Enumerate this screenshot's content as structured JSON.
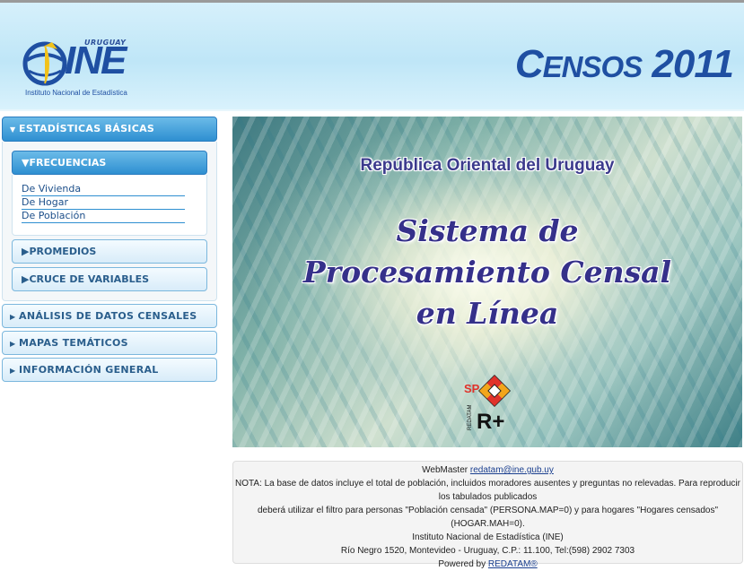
{
  "header": {
    "logo": {
      "country": "URUGUAY",
      "acronym": "INE",
      "subtitle": "Instituto Nacional de Estadística"
    },
    "censos_title_first": "C",
    "censos_title_rest": "ENSOS",
    "censos_year": "2011"
  },
  "sidebar": {
    "estadisticas_basicas": "ESTADÍSTICAS BÁSICAS",
    "frecuencias": "FRECUENCIAS",
    "frecuencias_links": [
      "De Vivienda",
      "De Hogar",
      "De Población"
    ],
    "promedios": "PROMEDIOS",
    "cruce_variables": "CRUCE DE VARIABLES",
    "analisis": "ANÁLISIS DE DATOS CENSALES",
    "mapas": "MAPAS TEMÁTICOS",
    "informacion": "INFORMACIÓN GENERAL"
  },
  "banner": {
    "country": "República Oriental del Uruguay",
    "line1": "Sistema de",
    "line2": "Procesamiento Censal",
    "line3": "en Línea",
    "logo_sp": "SP",
    "logo_r": "R+",
    "logo_vertical": "REDATAM"
  },
  "footer": {
    "webmaster_label": "WebMaster ",
    "webmaster_email": "redatam@ine.gub.uy",
    "note1": "NOTA: La base de datos incluye el total de población, incluidos moradores ausentes y preguntas no relevadas. Para reproducir los tabulados publicados",
    "note2": "deberá utilizar el filtro para personas \"Población censada\" (PERSONA.MAP=0) y para hogares \"Hogares censados\" (HOGAR.MAH=0).",
    "institute": "Instituto Nacional de Estadística (INE)",
    "address": "Río Negro 1520, Montevideo - Uruguay, C.P.: 11.100, Tel:(598) 2902 7303",
    "powered_label": "Powered by ",
    "powered_link": "REDATAM®"
  },
  "colors": {
    "brand_blue": "#1f4fa2",
    "accordion_active": "#2e8fd1",
    "header_bg": "#c8ebf9",
    "logo_yellow": "#f2c21b"
  }
}
